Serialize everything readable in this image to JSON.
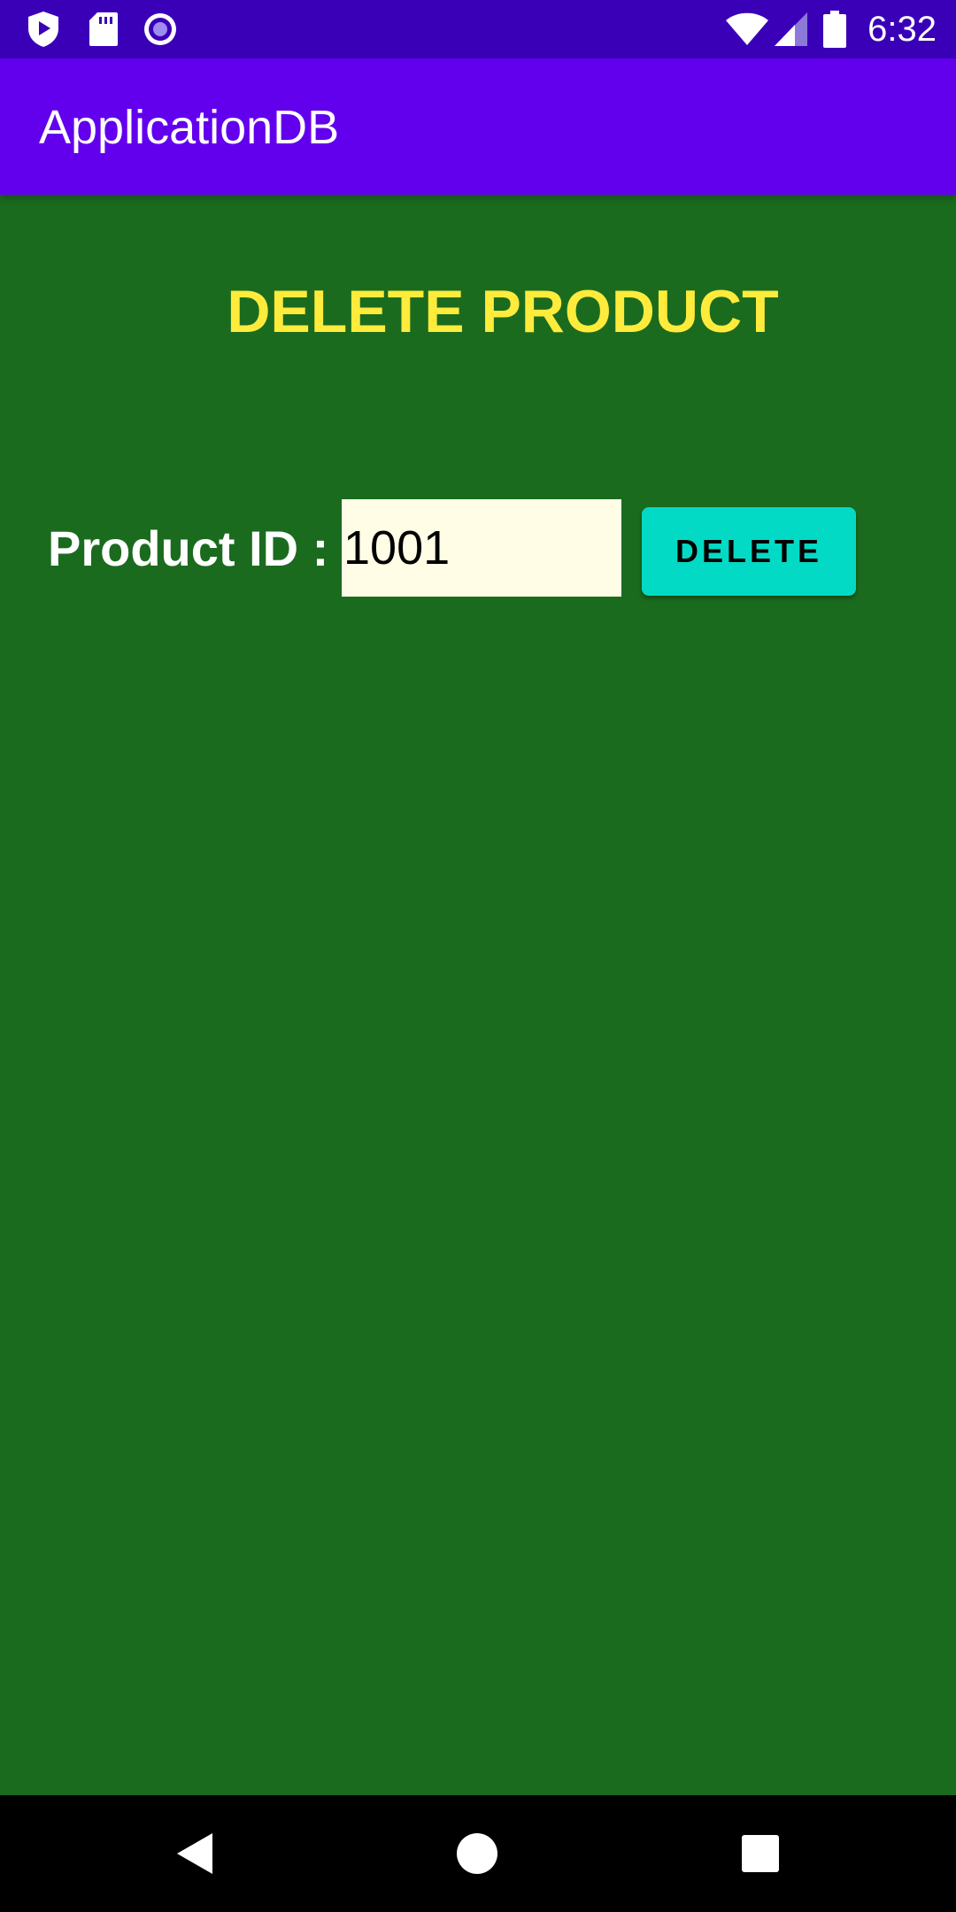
{
  "status_bar": {
    "time": "6:32",
    "icons": [
      "shield-play-icon",
      "sd-card-icon",
      "record-icon",
      "wifi-icon",
      "cellular-signal-icon",
      "battery-icon"
    ]
  },
  "app_bar": {
    "title": "ApplicationDB"
  },
  "main": {
    "heading": "DELETE PRODUCT",
    "product_id_label": "Product ID :",
    "product_id_value": "1001",
    "delete_button_label": "DELETE"
  },
  "nav_bar": {
    "icons": [
      "back-icon",
      "home-icon",
      "recents-icon"
    ]
  },
  "colors": {
    "status_bar": "#3a00b8",
    "app_bar": "#6200ee",
    "background": "#1b6b1f",
    "heading": "#ffeb3b",
    "input_bg": "#fffde6",
    "button": "#03dac5"
  }
}
